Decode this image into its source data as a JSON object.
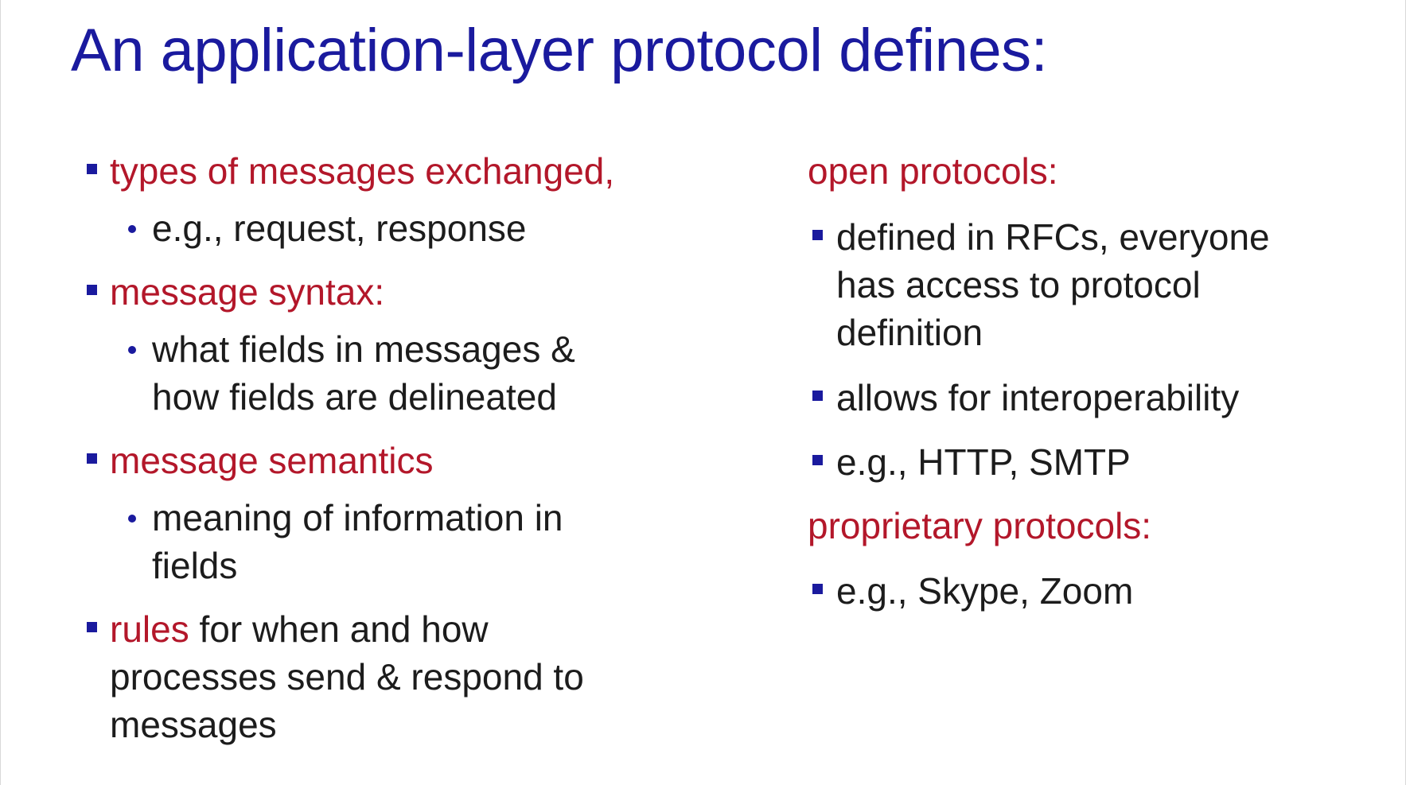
{
  "title": "An application-layer protocol defines:",
  "left": {
    "b1_heading": "types of messages exchanged,",
    "b1_sub": "e.g., request, response",
    "b2_heading": "message syntax:",
    "b2_sub_line1": "what fields in messages &",
    "b2_sub_line2": "how fields are delineated",
    "b3_heading": "message semantics",
    "b3_sub_line1": "meaning of information in",
    "b3_sub_line2": "fields",
    "b4_keyword": "rules",
    "b4_line1_rest": " for when and how",
    "b4_line2": "processes send & respond to",
    "b4_line3": "messages"
  },
  "right": {
    "open_heading": "open protocols:",
    "open_b1_line1": "defined in RFCs, everyone",
    "open_b1_line2": "has access to protocol",
    "open_b1_line3": "definition",
    "open_b2": "allows for interoperability",
    "open_b3": "e.g., HTTP, SMTP",
    "prop_heading": "proprietary protocols:",
    "prop_b1": "e.g., Skype, Zoom"
  },
  "colors": {
    "title": "#1a1a9e",
    "bullet": "#1a1a9e",
    "heading_red": "#b3172a",
    "body_text": "#1c1c1c"
  }
}
